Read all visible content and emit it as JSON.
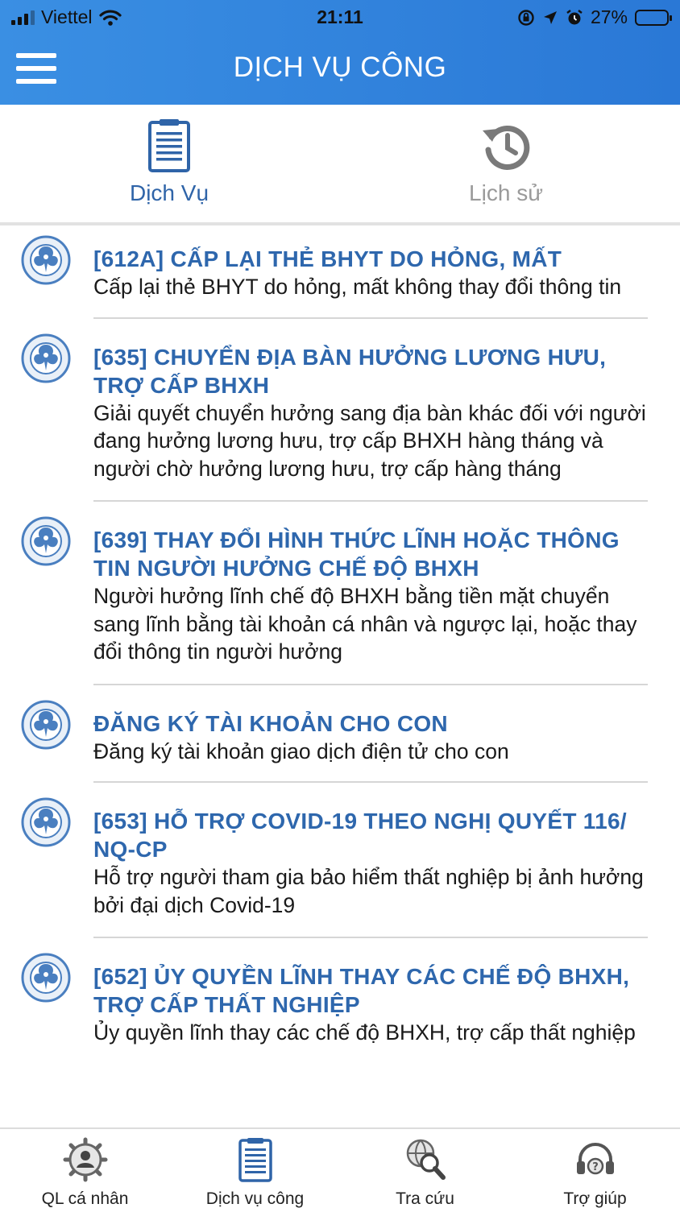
{
  "status": {
    "carrier": "Viettel",
    "time": "21:11",
    "battery": "27%",
    "battery_level": 0.27
  },
  "header": {
    "title": "DỊCH VỤ CÔNG",
    "menu_icon": "hamburger-menu-icon"
  },
  "tabs": [
    {
      "label": "Dịch Vụ",
      "icon": "document-list-icon",
      "active": true,
      "color": "#2f64a8"
    },
    {
      "label": "Lịch sử",
      "icon": "history-icon",
      "active": false,
      "color": "#9a9a9a"
    }
  ],
  "services": [
    {
      "title": "[612A] CẤP LẠI THẺ BHYT DO HỎNG, MẤT",
      "desc": "Cấp lại thẻ BHYT do hỏng, mất không thay đổi thông tin"
    },
    {
      "title": "[635] CHUYỂN ĐỊA BÀN HƯỞNG LƯƠNG HƯU, TRỢ CẤP BHXH",
      "desc": "Giải quyết chuyển hưởng sang địa bàn khác đối với người đang hưởng lương hưu, trợ cấp BHXH hàng tháng và người chờ hưởng lương hưu, trợ cấp hàng tháng"
    },
    {
      "title": "[639] THAY ĐỔI HÌNH THỨC LĨNH HOẶC THÔNG TIN NGƯỜI HƯỞNG CHẾ ĐỘ BHXH",
      "desc": "Người hưởng lĩnh chế độ BHXH bằng tiền mặt chuyển sang lĩnh bằng tài khoản cá nhân và ngược lại, hoặc thay đổi thông tin người hưởng"
    },
    {
      "title": "ĐĂNG KÝ TÀI KHOẢN CHO CON",
      "desc": "Đăng ký tài khoản giao dịch điện tử cho con"
    },
    {
      "title": "[653] HỖ TRỢ COVID-19 THEO NGHỊ QUYẾT 116/ NQ-CP",
      "desc": "Hỗ trợ người tham gia bảo hiểm thất nghiệp bị ảnh hưởng bởi đại dịch Covid-19"
    },
    {
      "title": "[652] ỦY QUYỀN LĨNH THAY CÁC CHẾ ĐỘ BHXH, TRỢ CẤP THẤT NGHIỆP",
      "desc": "Ủy quyền lĩnh thay các chế độ BHXH, trợ cấp thất nghiệp"
    }
  ],
  "bottom_nav": [
    {
      "label": "QL cá nhân",
      "icon": "personal-gear-icon"
    },
    {
      "label": "Dịch vụ công",
      "icon": "document-list-icon"
    },
    {
      "label": "Tra cứu",
      "icon": "globe-search-icon"
    },
    {
      "label": "Trợ giúp",
      "icon": "headset-help-icon"
    }
  ],
  "colors": {
    "header_blue": "#2a78d6",
    "title_blue": "#2e67ad"
  }
}
